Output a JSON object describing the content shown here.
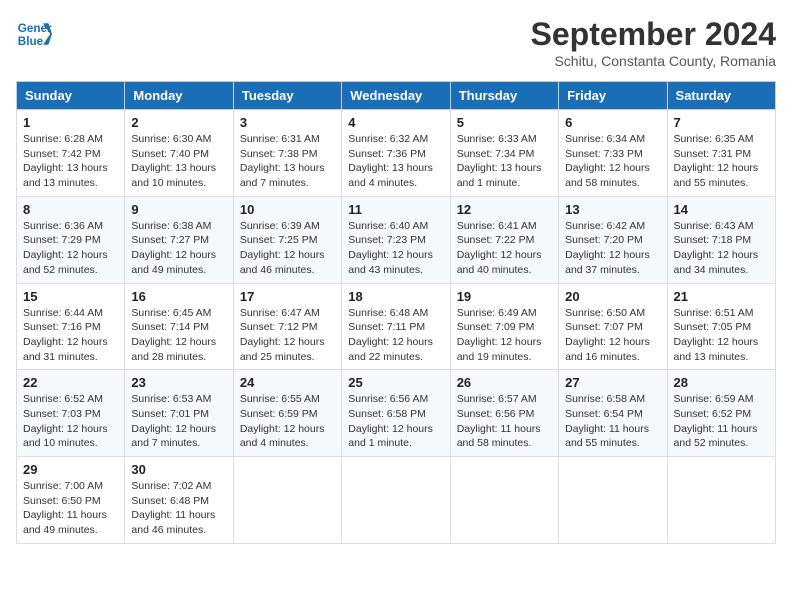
{
  "header": {
    "logo_line1": "General",
    "logo_line2": "Blue",
    "month_title": "September 2024",
    "subtitle": "Schitu, Constanta County, Romania"
  },
  "weekdays": [
    "Sunday",
    "Monday",
    "Tuesday",
    "Wednesday",
    "Thursday",
    "Friday",
    "Saturday"
  ],
  "weeks": [
    [
      {
        "day": "1",
        "sunrise": "6:28 AM",
        "sunset": "7:42 PM",
        "daylight": "13 hours and 13 minutes."
      },
      {
        "day": "2",
        "sunrise": "6:30 AM",
        "sunset": "7:40 PM",
        "daylight": "13 hours and 10 minutes."
      },
      {
        "day": "3",
        "sunrise": "6:31 AM",
        "sunset": "7:38 PM",
        "daylight": "13 hours and 7 minutes."
      },
      {
        "day": "4",
        "sunrise": "6:32 AM",
        "sunset": "7:36 PM",
        "daylight": "13 hours and 4 minutes."
      },
      {
        "day": "5",
        "sunrise": "6:33 AM",
        "sunset": "7:34 PM",
        "daylight": "13 hours and 1 minute."
      },
      {
        "day": "6",
        "sunrise": "6:34 AM",
        "sunset": "7:33 PM",
        "daylight": "12 hours and 58 minutes."
      },
      {
        "day": "7",
        "sunrise": "6:35 AM",
        "sunset": "7:31 PM",
        "daylight": "12 hours and 55 minutes."
      }
    ],
    [
      {
        "day": "8",
        "sunrise": "6:36 AM",
        "sunset": "7:29 PM",
        "daylight": "12 hours and 52 minutes."
      },
      {
        "day": "9",
        "sunrise": "6:38 AM",
        "sunset": "7:27 PM",
        "daylight": "12 hours and 49 minutes."
      },
      {
        "day": "10",
        "sunrise": "6:39 AM",
        "sunset": "7:25 PM",
        "daylight": "12 hours and 46 minutes."
      },
      {
        "day": "11",
        "sunrise": "6:40 AM",
        "sunset": "7:23 PM",
        "daylight": "12 hours and 43 minutes."
      },
      {
        "day": "12",
        "sunrise": "6:41 AM",
        "sunset": "7:22 PM",
        "daylight": "12 hours and 40 minutes."
      },
      {
        "day": "13",
        "sunrise": "6:42 AM",
        "sunset": "7:20 PM",
        "daylight": "12 hours and 37 minutes."
      },
      {
        "day": "14",
        "sunrise": "6:43 AM",
        "sunset": "7:18 PM",
        "daylight": "12 hours and 34 minutes."
      }
    ],
    [
      {
        "day": "15",
        "sunrise": "6:44 AM",
        "sunset": "7:16 PM",
        "daylight": "12 hours and 31 minutes."
      },
      {
        "day": "16",
        "sunrise": "6:45 AM",
        "sunset": "7:14 PM",
        "daylight": "12 hours and 28 minutes."
      },
      {
        "day": "17",
        "sunrise": "6:47 AM",
        "sunset": "7:12 PM",
        "daylight": "12 hours and 25 minutes."
      },
      {
        "day": "18",
        "sunrise": "6:48 AM",
        "sunset": "7:11 PM",
        "daylight": "12 hours and 22 minutes."
      },
      {
        "day": "19",
        "sunrise": "6:49 AM",
        "sunset": "7:09 PM",
        "daylight": "12 hours and 19 minutes."
      },
      {
        "day": "20",
        "sunrise": "6:50 AM",
        "sunset": "7:07 PM",
        "daylight": "12 hours and 16 minutes."
      },
      {
        "day": "21",
        "sunrise": "6:51 AM",
        "sunset": "7:05 PM",
        "daylight": "12 hours and 13 minutes."
      }
    ],
    [
      {
        "day": "22",
        "sunrise": "6:52 AM",
        "sunset": "7:03 PM",
        "daylight": "12 hours and 10 minutes."
      },
      {
        "day": "23",
        "sunrise": "6:53 AM",
        "sunset": "7:01 PM",
        "daylight": "12 hours and 7 minutes."
      },
      {
        "day": "24",
        "sunrise": "6:55 AM",
        "sunset": "6:59 PM",
        "daylight": "12 hours and 4 minutes."
      },
      {
        "day": "25",
        "sunrise": "6:56 AM",
        "sunset": "6:58 PM",
        "daylight": "12 hours and 1 minute."
      },
      {
        "day": "26",
        "sunrise": "6:57 AM",
        "sunset": "6:56 PM",
        "daylight": "11 hours and 58 minutes."
      },
      {
        "day": "27",
        "sunrise": "6:58 AM",
        "sunset": "6:54 PM",
        "daylight": "11 hours and 55 minutes."
      },
      {
        "day": "28",
        "sunrise": "6:59 AM",
        "sunset": "6:52 PM",
        "daylight": "11 hours and 52 minutes."
      }
    ],
    [
      {
        "day": "29",
        "sunrise": "7:00 AM",
        "sunset": "6:50 PM",
        "daylight": "11 hours and 49 minutes."
      },
      {
        "day": "30",
        "sunrise": "7:02 AM",
        "sunset": "6:48 PM",
        "daylight": "11 hours and 46 minutes."
      },
      null,
      null,
      null,
      null,
      null
    ]
  ]
}
